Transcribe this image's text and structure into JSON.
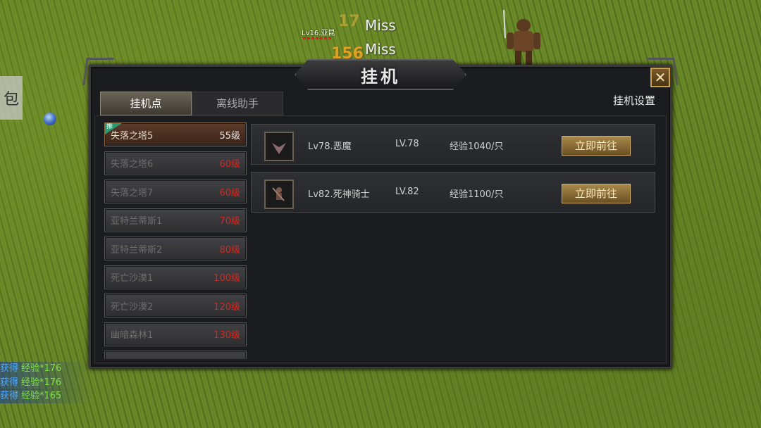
{
  "world": {
    "player_name": "Lv16.亚昆",
    "miss_texts": [
      "Miss",
      "Miss"
    ],
    "damage_text": "156",
    "bag_label": "包",
    "log": [
      {
        "label": "获得",
        "value": "经验*176"
      },
      {
        "label": "获得",
        "value": "经验*176"
      },
      {
        "label": "获得",
        "value": "经验*165"
      }
    ]
  },
  "panel": {
    "title": "挂机",
    "close_label": "✕",
    "tabs": [
      {
        "label": "挂机点",
        "active": true
      },
      {
        "label": "离线助手",
        "active": false
      }
    ],
    "settings_label": "挂机设置",
    "locations": [
      {
        "name": "失落之塔5",
        "level": "55级",
        "selected": true,
        "badge": "推"
      },
      {
        "name": "失落之塔6",
        "level": "60级"
      },
      {
        "name": "失落之塔7",
        "level": "60级"
      },
      {
        "name": "亚特兰蒂斯1",
        "level": "70级"
      },
      {
        "name": "亚特兰蒂斯2",
        "level": "80级"
      },
      {
        "name": "死亡沙漠1",
        "level": "100级"
      },
      {
        "name": "死亡沙漠2",
        "level": "120级"
      },
      {
        "name": "幽暗森林1",
        "level": "130级"
      }
    ],
    "monsters": [
      {
        "name": "Lv78.恶魔",
        "lv": "LV.78",
        "exp": "经验1040/只",
        "button": "立即前往",
        "icon": "demon-icon"
      },
      {
        "name": "Lv82.死神骑士",
        "lv": "LV.82",
        "exp": "经验1100/只",
        "button": "立即前往",
        "icon": "death-knight-icon"
      }
    ]
  },
  "colors": {
    "level_red": "#d8271f",
    "button_gold": "#a8884a",
    "log_blue": "#4fa8ff",
    "log_green": "#7fe04a"
  }
}
